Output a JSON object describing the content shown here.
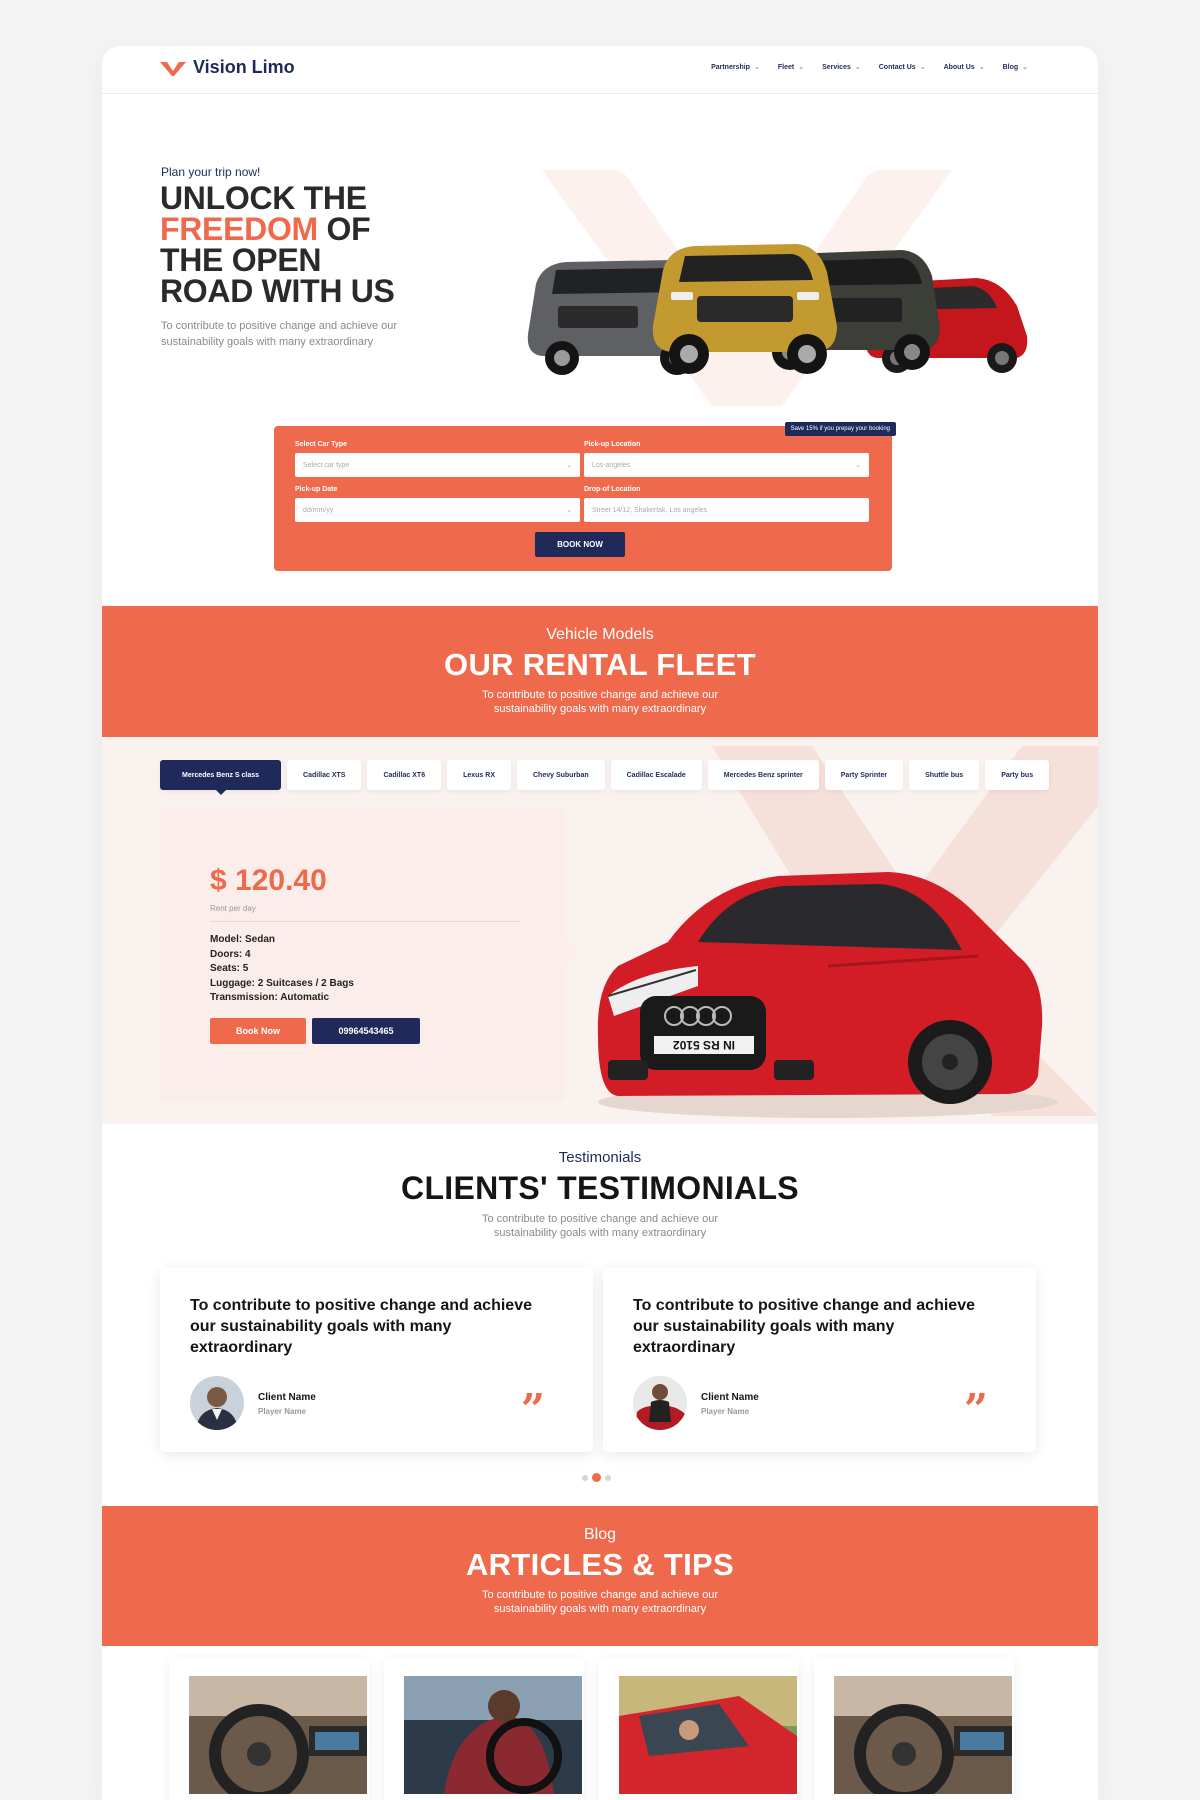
{
  "header": {
    "brand": "Vision Limo",
    "nav": [
      "Partnership",
      "Fleet",
      "Services",
      "Contact Us",
      "About Us",
      "Blog"
    ]
  },
  "hero": {
    "eyebrow": "Plan your trip now!",
    "title_line1": "UNLOCK THE",
    "title_accent": "FREEDOM",
    "title_after_accent": " OF",
    "title_line3": "THE OPEN",
    "title_line4": "ROAD WITH US",
    "subtitle": "To contribute to positive change and achieve our sustainability goals with many extraordinary"
  },
  "booking": {
    "promo": "Save 15% if you prepay your booking",
    "car_type_label": "Select Car Type",
    "car_type_placeholder": "Select car type",
    "pickup_location_label": "Pick-up Location",
    "pickup_location_value": "Los-angeles",
    "pickup_date_label": "Pick-up Date",
    "pickup_date_placeholder": "dd/mm/yy",
    "dropoff_label": "Drop-of Location",
    "dropoff_placeholder": "Street 14/12, Shakertak, Los angeles",
    "submit": "BOOK NOW"
  },
  "fleet": {
    "eyebrow": "Vehicle Models",
    "title": "OUR RENTAL FLEET",
    "subtitle": "To contribute to positive change and achieve our sustainability goals with many extraordinary",
    "tabs": [
      "Mercedes Benz S class",
      "Cadillac XTS",
      "Cadillac XT6",
      "Lexus RX",
      "Chevy Suburban",
      "Cadillac Escalade",
      "Mercedes Benz sprinter",
      "Party Sprinter",
      "Shuttle bus",
      "Party bus"
    ],
    "active_tab": "Mercedes Benz S class",
    "price": "$ 120.40",
    "price_note": "Rent per day",
    "specs": [
      "Model: Sedan",
      "Doors: 4",
      "Seats: 5",
      "Luggage: 2 Suitcases / 2 Bags",
      "Transmission: Automatic"
    ],
    "book_label": "Book Now",
    "phone": "09964543465",
    "plate": "IN RS 5102"
  },
  "testimonials": {
    "eyebrow": "Testimonials",
    "title": "CLIENTS' TESTIMONIALS",
    "subtitle": "To contribute to positive change and achieve our sustainability goals with many extraordinary",
    "items": [
      {
        "quote": "To contribute to positive change and achieve our sustainability goals with many extraordinary",
        "name": "Client Name",
        "role": "Player Name"
      },
      {
        "quote": "To contribute to positive change and achieve our sustainability goals with many extraordinary",
        "name": "Client Name",
        "role": "Player Name"
      }
    ],
    "active_dot": 2,
    "dot_count": 3
  },
  "blog": {
    "eyebrow": "Blog",
    "title": "ARTICLES & TIPS",
    "subtitle": "To contribute to positive change and achieve our sustainability goals with many extraordinary"
  },
  "colors": {
    "accent": "#ef6a4c",
    "navy": "#1f2a5a",
    "tint": "#faf2ef"
  }
}
